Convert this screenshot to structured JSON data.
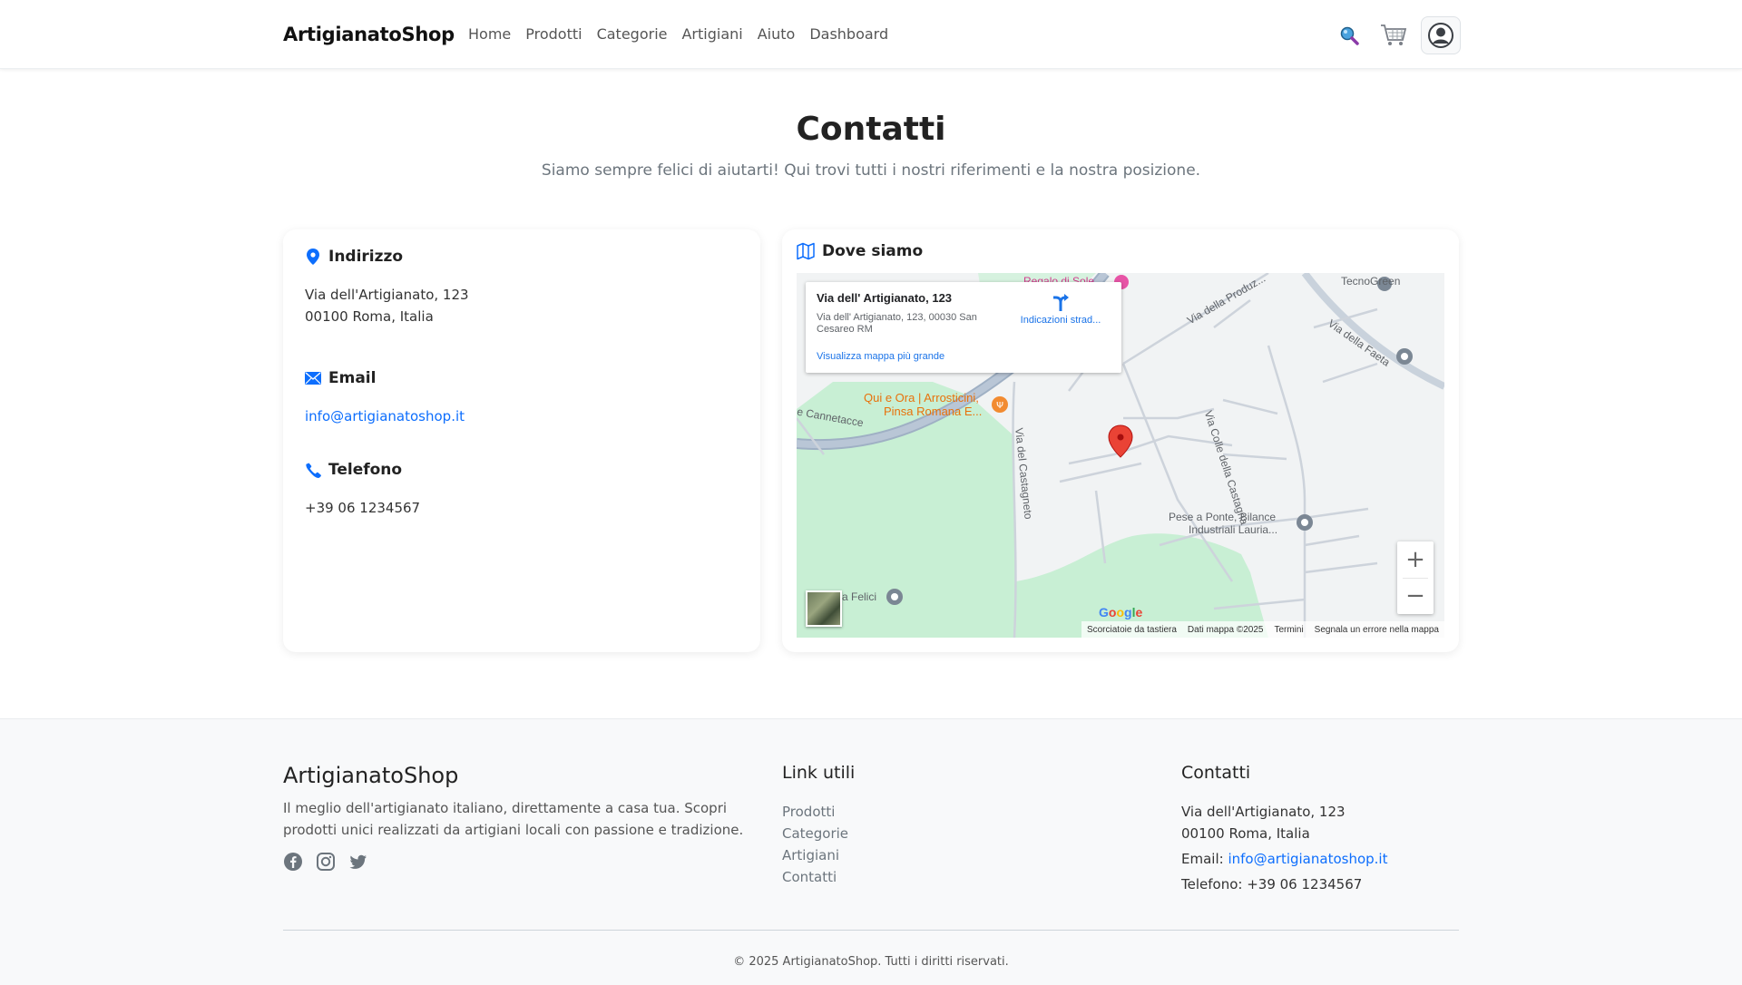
{
  "header": {
    "brand": "ArtigianatoShop",
    "nav": [
      "Home",
      "Prodotti",
      "Categorie",
      "Artigiani",
      "Aiuto",
      "Dashboard"
    ],
    "icons": [
      "search-icon",
      "cart-icon",
      "user-icon"
    ]
  },
  "page": {
    "title": "Contatti",
    "subtitle": "Siamo sempre felici di aiutarti! Qui trovi tutti i nostri riferimenti e la nostra posizione."
  },
  "contact": {
    "address_title": "Indirizzo",
    "address_line1": "Via dell'Artigianato, 123",
    "address_line2": "00100 Roma, Italia",
    "email_title": "Email",
    "email": "info@artigianatoshop.it",
    "phone_title": "Telefono",
    "phone": "+39 06 1234567"
  },
  "map": {
    "title": "Dove siamo",
    "popup_title": "Via dell' Artigianato, 123",
    "popup_address": "Via dell' Artigianato, 123, 00030 San Cesareo RM",
    "popup_directions": "Indicazioni strad...",
    "popup_link": "Visualizza mappa più grande",
    "labels": {
      "tecnogreen": "TecnoGreen",
      "via_produz": "Via della Produz...",
      "via_faeta": "Via della Faeta",
      "via_colle": "Via Colle della Castagna",
      "qui_e_ora_1": "Qui e Ora | Arrosticini,",
      "qui_e_ora_2": "Pinsa Romana E...",
      "cannetacce": "e Cannetacce",
      "castagneto": "Via del Castagneto",
      "pese_1": "Pese a Ponte, Bilance",
      "pese_2": "Industriali Lauria...",
      "felici": "a Felici",
      "top_poi": "Regalo di Sole"
    },
    "zoom_in": "+",
    "zoom_out": "−",
    "google": "Google",
    "attribution": [
      "Scorciatoie da tastiera",
      "Dati mappa ©2025",
      "Termini",
      "Segnala un errore nella mappa"
    ],
    "colors": {
      "park": "#c8efd4",
      "road": "#aab9c9",
      "pin": "#ea4335"
    }
  },
  "footer": {
    "brand": "ArtigianatoShop",
    "description": "Il meglio dell'artigianato italiano, direttamente a casa tua. Scopri prodotti unici realizzati da artigiani locali con passione e tradizione.",
    "social": [
      "facebook-icon",
      "instagram-icon",
      "twitter-icon"
    ],
    "links_title": "Link utili",
    "links": [
      "Prodotti",
      "Categorie",
      "Artigiani",
      "Contatti"
    ],
    "contact_title": "Contatti",
    "contact_line1": "Via dell'Artigianato, 123",
    "contact_line2": "00100 Roma, Italia",
    "email_label": "Email: ",
    "email": "info@artigianatoshop.it",
    "phone_line": "Telefono: +39 06 1234567",
    "copyright": "© 2025 ArtigianatoShop. Tutti i diritti riservati."
  }
}
